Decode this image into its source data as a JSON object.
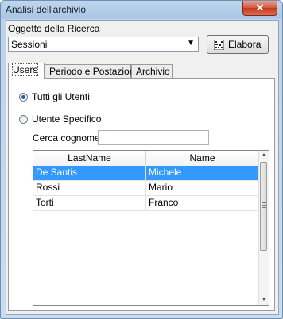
{
  "window": {
    "title": "Analisi dell'archivio",
    "close_glyph": "✕"
  },
  "oggetto": {
    "label": "Oggetto della Ricerca",
    "selected": "Sessioni",
    "arrow_icon": "chevron-down-icon",
    "elabora_label": "Elabora",
    "elabora_icon": "barcode-icon"
  },
  "tabs": [
    {
      "label": "Users"
    },
    {
      "label": "Periodo e Postazioni"
    },
    {
      "label": "Archivio"
    }
  ],
  "users": {
    "option_all": "Tutti gli Utenti",
    "option_specific": "Utente Specifico",
    "search_label": "Cerca cognome",
    "search_value": "",
    "selected_option": "all",
    "columns": [
      "LastName",
      "Name"
    ],
    "rows": [
      {
        "lastname": "De Santis",
        "name": "Michele",
        "selected": true
      },
      {
        "lastname": "Rossi",
        "name": "Mario",
        "selected": false
      },
      {
        "lastname": "Torti",
        "name": "Franco",
        "selected": false
      }
    ]
  },
  "colors": {
    "selection": "#3399ff",
    "close": "#c23a20"
  }
}
